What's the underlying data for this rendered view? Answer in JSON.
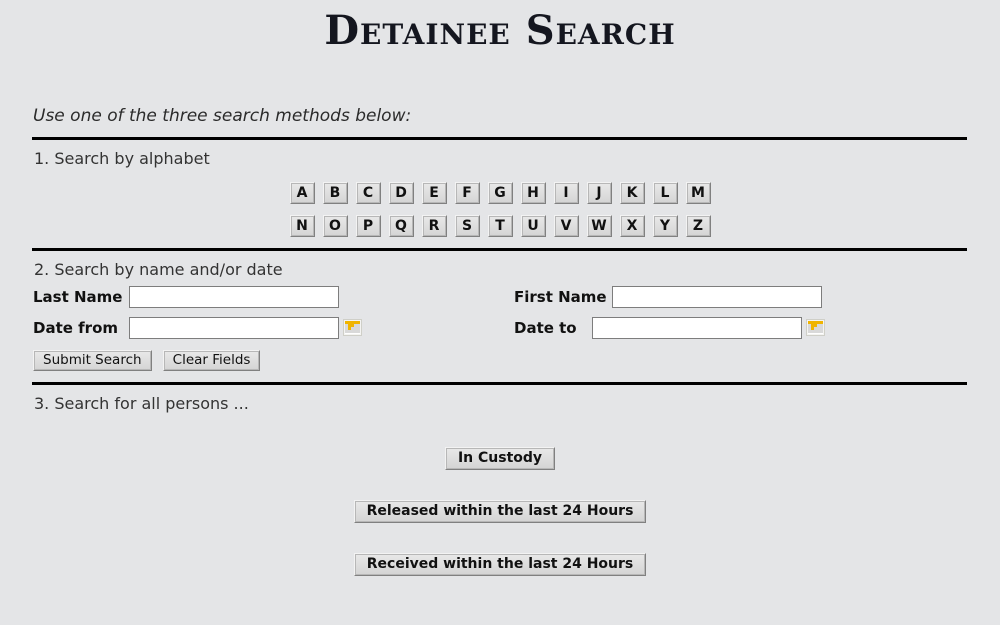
{
  "page": {
    "title": "Detainee Search",
    "intro": "Use one of the three search methods below:"
  },
  "section1": {
    "label": "1. Search by alphabet",
    "letters_row1": [
      "A",
      "B",
      "C",
      "D",
      "E",
      "F",
      "G",
      "H",
      "I",
      "J",
      "K",
      "L",
      "M"
    ],
    "letters_row2": [
      "N",
      "O",
      "P",
      "Q",
      "R",
      "S",
      "T",
      "U",
      "V",
      "W",
      "X",
      "Y",
      "Z"
    ]
  },
  "section2": {
    "label": "2. Search by name and/or date",
    "last_name_label": "Last Name",
    "last_name_value": "",
    "first_name_label": "First Name",
    "first_name_value": "",
    "date_from_label": "Date from",
    "date_from_value": "",
    "date_to_label": "Date to",
    "date_to_value": "",
    "calendar_icon_name": "calendar-icon",
    "submit_label": "Submit Search",
    "clear_label": "Clear Fields"
  },
  "section3": {
    "label": "3. Search for all persons ...",
    "in_custody_label": "In Custody",
    "released_label": "Released within the last 24 Hours",
    "received_label": "Received within the last 24 Hours"
  },
  "colors": {
    "background": "#e4e5e7",
    "title": "#14161f",
    "rule": "#000000",
    "button_face": "#dcdcdc",
    "calendar_accent": "#f0b400"
  }
}
